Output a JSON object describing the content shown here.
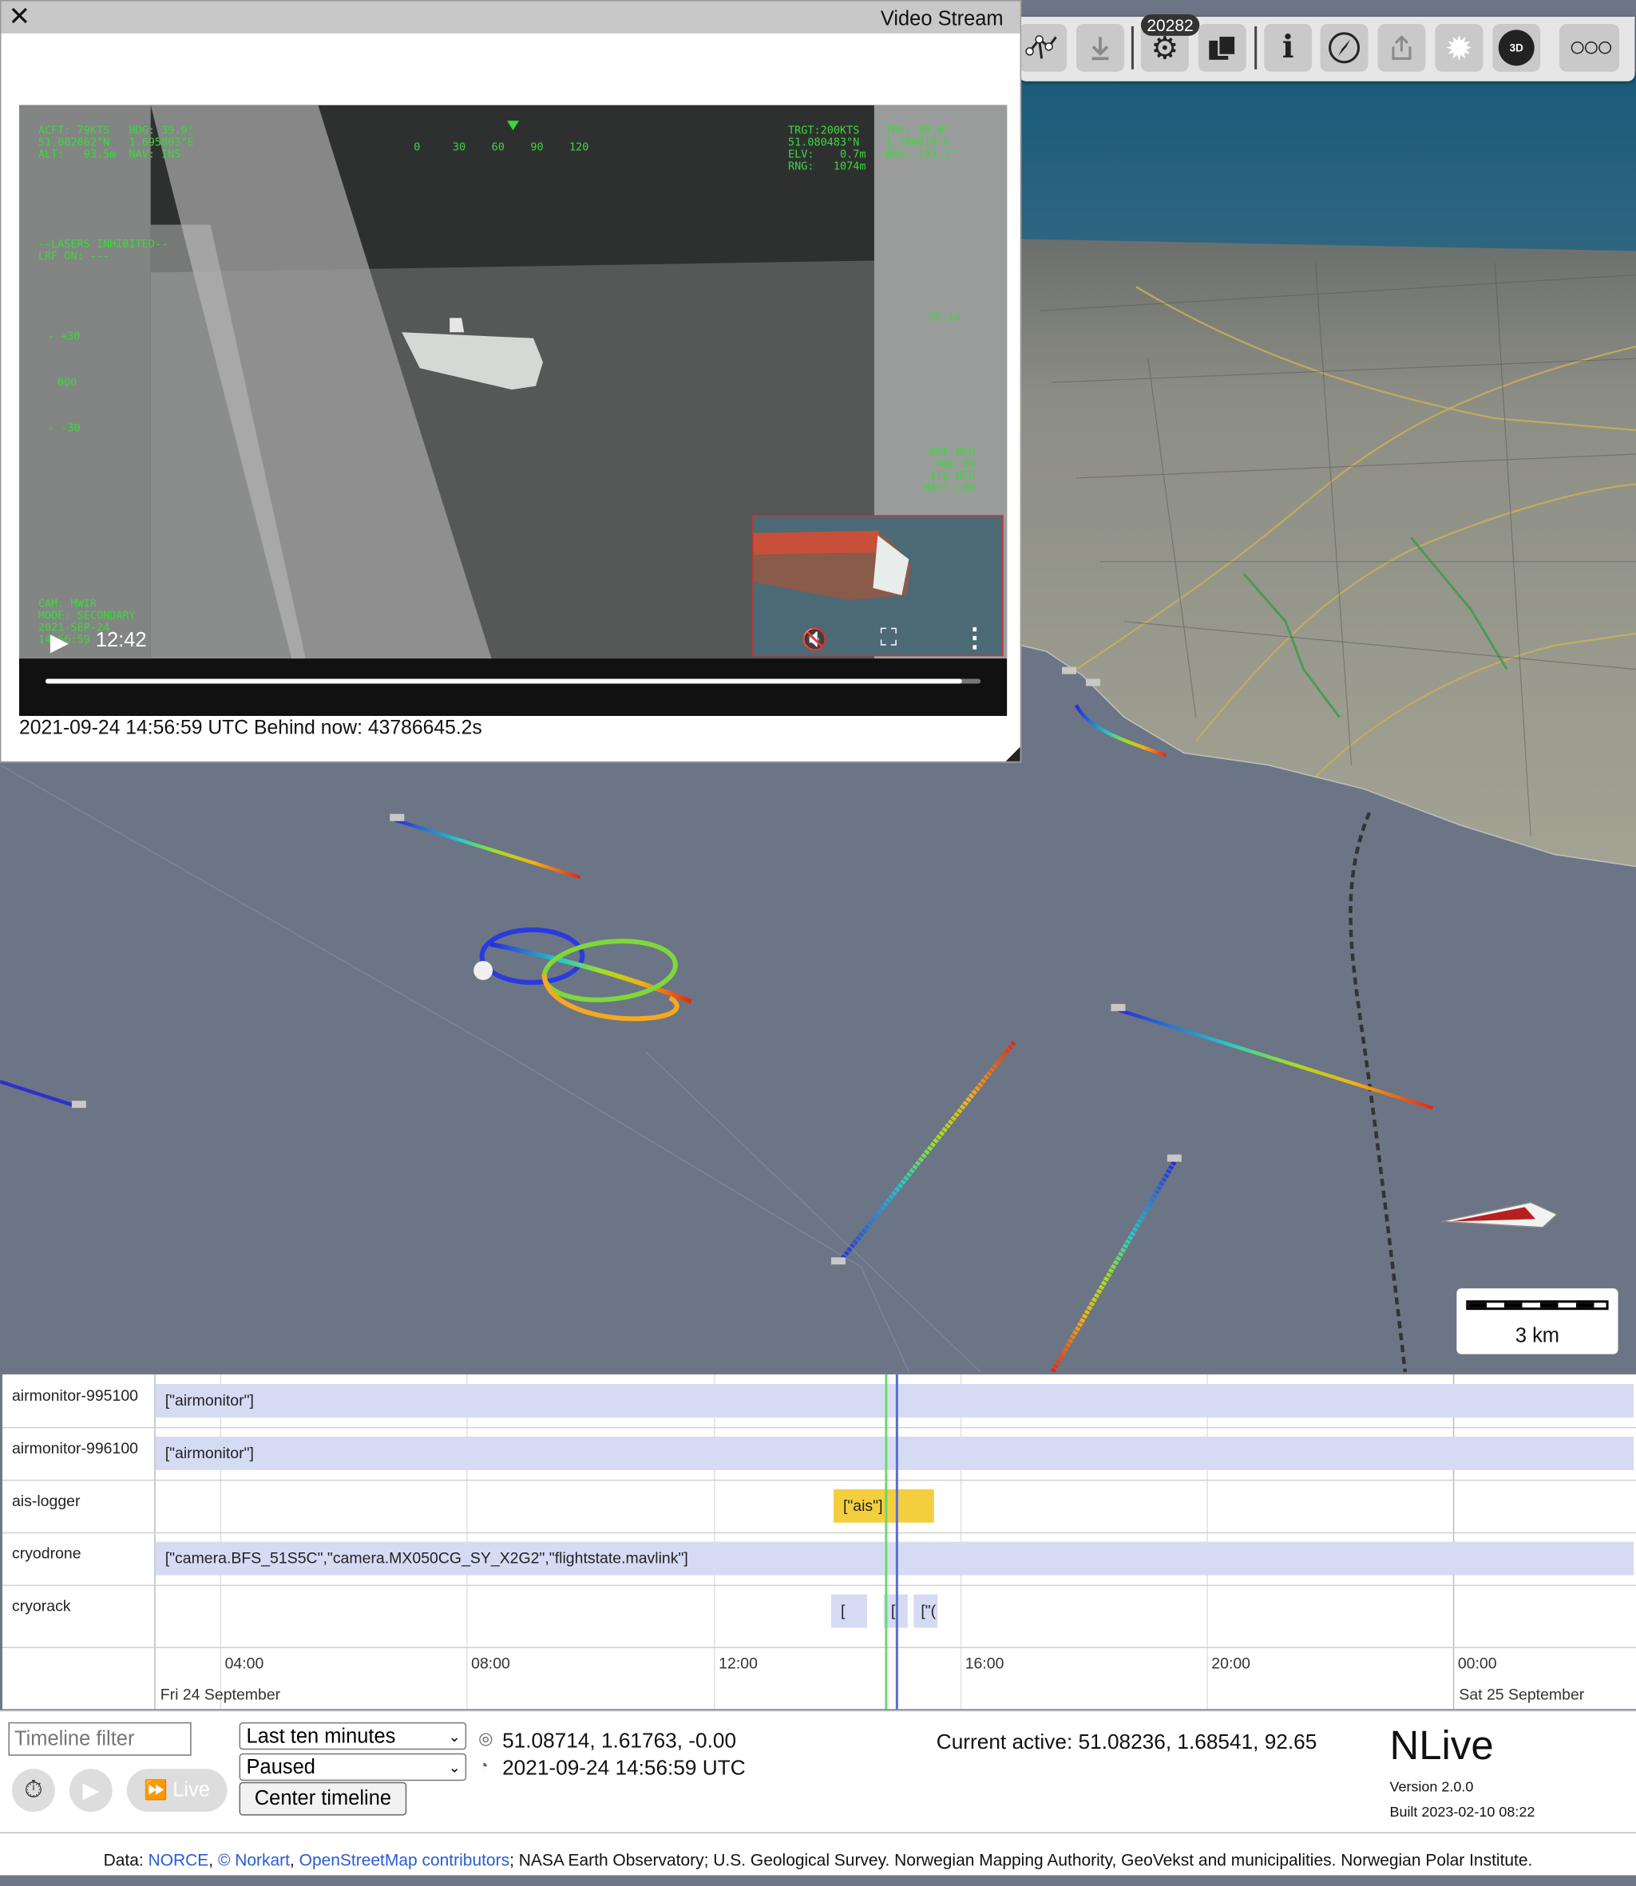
{
  "toolbar": {
    "badge": "20282",
    "buttons": [
      "route-icon",
      "download-icon",
      "settings-icon",
      "layers-icon",
      "info-icon",
      "compass-icon",
      "share-icon",
      "sun-icon",
      "3d-icon",
      "more-icon"
    ],
    "view_mode": "3D"
  },
  "video_window": {
    "title": "Video Stream",
    "time": "12:42",
    "status": "2021-09-24 14:56:59 UTC Behind now: 43786645.2s",
    "progress": 0.98,
    "hud": {
      "top_left": "ACFT: 79KTS   HDG: 39.9°\n51.082862°N   1.695803°E\nALT:   93.5m  NAV: INS",
      "top_right": "TRGT:200KTS    TRK: 39.9°\n51.080483°N    1.700619°E\nELV:    0.7m   BRG: 103.1°\nRNG:   1074m",
      "compass_scale": "0     30    60    90    120",
      "lasers": "--LASERS INHIBITED--\nLRF ON: ---",
      "pitch_top": "- +30",
      "pitch_mid": "000",
      "pitch_bottom": "- -30",
      "range": "50.1m",
      "modes": "DDE MED\nAGC ON\nITG MED\nHIST LOW",
      "bottom_left": "CAM: MWIR\nMODE: SECONDARY\n2021-SEP-24\n14:56:59"
    }
  },
  "map": {
    "scale_label": "3 km"
  },
  "timeline": {
    "rows": [
      {
        "name": "airmonitor-995100",
        "bar": "[\"airmonitor\"]"
      },
      {
        "name": "airmonitor-996100",
        "bar": "[\"airmonitor\"]"
      },
      {
        "name": "ais-logger",
        "bar": "[\"ais\"]"
      },
      {
        "name": "cryodrone",
        "bar": "[\"camera.BFS_51S5C\",\"camera.MX050CG_SY_X2G2\",\"flightstate.mavlink\"]"
      },
      {
        "name": "cryorack",
        "bar": "[",
        "bar2": "['",
        "bar3": "[\"("
      }
    ],
    "ticks": [
      "04:00",
      "08:00",
      "12:00",
      "16:00",
      "20:00",
      "00:00"
    ],
    "date_left": "Fri 24 September",
    "date_right": "Sat 25 September"
  },
  "controls": {
    "filter_placeholder": "Timeline filter",
    "range_option": "Last ten minutes",
    "play_state": "Paused",
    "center_button": "Center timeline",
    "live_label": "Live",
    "cursor_coords": "51.08714, 1.61763, -0.00",
    "utc_time": "2021-09-24 14:56:59 UTC",
    "current_active": "Current active: 51.08236, 1.68541, 92.65",
    "app_name": "NLive",
    "version": "Version 2.0.0",
    "built": "Built 2023-02-10 08:22"
  },
  "footer": {
    "prefix": "Data: ",
    "link1": "NORCE",
    "sep1": ", ",
    "link2": "© Norkart",
    "sep2": ", ",
    "link3": "OpenStreetMap contributors",
    "rest": "; NASA Earth Observatory; U.S. Geological Survey. Norwegian Mapping Authority, GeoVekst and municipalities. Norwegian Polar Institute."
  }
}
